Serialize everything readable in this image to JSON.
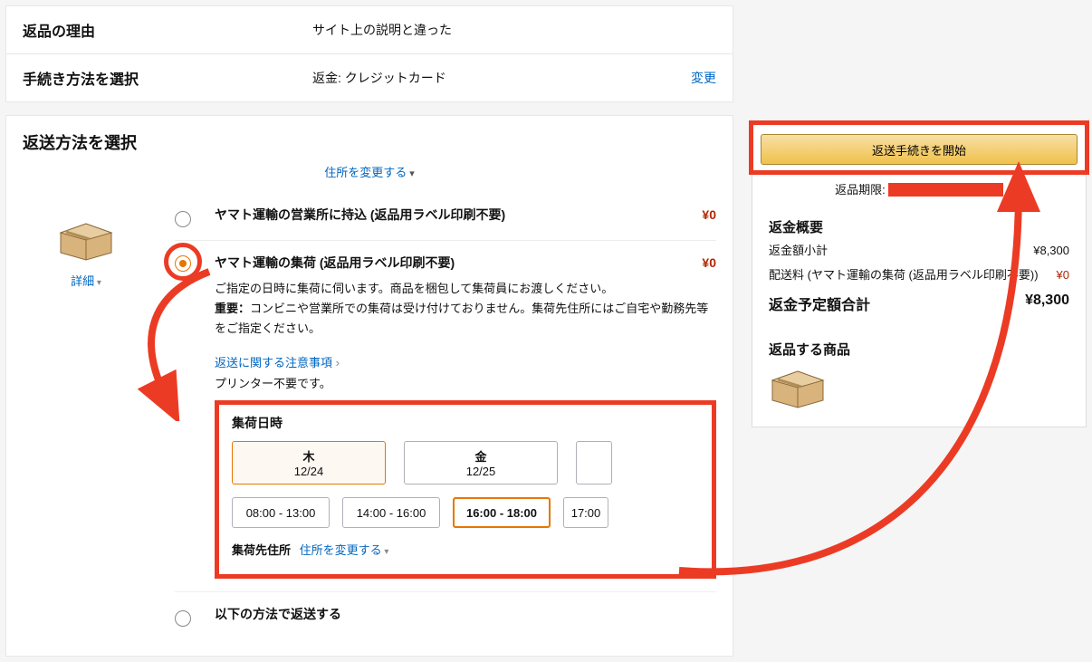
{
  "reason": {
    "label": "返品の理由",
    "value": "サイト上の説明と違った"
  },
  "method": {
    "label": "手続き方法を選択",
    "value": "返金: クレジットカード",
    "change": "変更"
  },
  "ship": {
    "title": "返送方法を選択",
    "change_address": "住所を変更する",
    "details": "詳細"
  },
  "options": [
    {
      "id": "dropoff",
      "title": "ヤマト運輸の営業所に持込 (返品用ラベル印刷不要)",
      "price": "¥0"
    },
    {
      "id": "pickup",
      "title": "ヤマト運輸の集荷 (返品用ラベル印刷不要)",
      "price": "¥0",
      "desc": "ご指定の日時に集荷に伺います。商品を梱包して集荷員にお渡しください。",
      "warn_bold": "重要：",
      "warn": "コンビニや営業所での集荷は受け付けておりません。集荷先住所にはご自宅や勤務先等をご指定ください。",
      "notice_link": "返送に関する注意事項",
      "printer": "プリンター不要です。"
    },
    {
      "id": "other",
      "title": "以下の方法で返送する"
    }
  ],
  "pickup": {
    "title": "集荷日時",
    "dates": [
      {
        "dow": "木",
        "date": "12/24",
        "selected": true
      },
      {
        "dow": "金",
        "date": "12/25",
        "selected": false
      }
    ],
    "times": [
      {
        "label": "08:00 - 13:00",
        "selected": false
      },
      {
        "label": "14:00 - 16:00",
        "selected": false
      },
      {
        "label": "16:00 - 18:00",
        "selected": true
      },
      {
        "label": "17:00",
        "selected": false,
        "partial": true
      }
    ],
    "address_label": "集荷先住所",
    "address_change": "住所を変更する"
  },
  "side": {
    "start_button": "返送手続きを開始",
    "deadline_prefix": "返品期限:",
    "summary_title": "返金概要",
    "rows": [
      {
        "k": "返金額小計",
        "v": "¥8,300"
      },
      {
        "k": "配送料 (ヤマト運輸の集荷 (返品用ラベル印刷不要))",
        "v": "¥0",
        "red": true
      }
    ],
    "total_label": "返金予定額合計",
    "total_value": "¥8,300",
    "items_title": "返品する商品"
  }
}
